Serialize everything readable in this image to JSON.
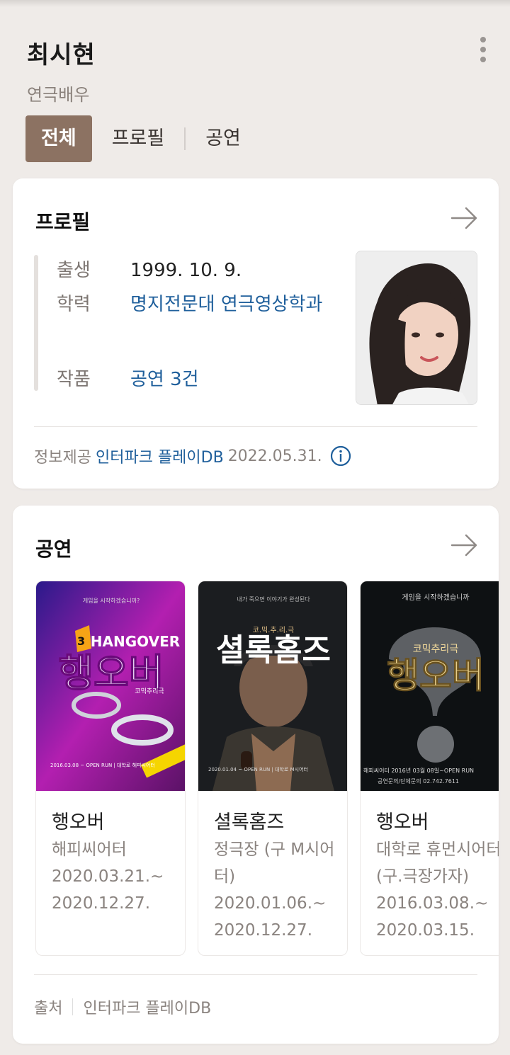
{
  "person": {
    "name": "최시현",
    "job": "연극배우"
  },
  "tabs": [
    "전체",
    "프로필",
    "공연"
  ],
  "profile": {
    "title": "프로필",
    "rows": [
      {
        "label": "출생",
        "value": "1999. 10. 9."
      },
      {
        "label": "학력",
        "value": "명지전문대 연극영상학과"
      },
      {
        "label": "작품",
        "value": "공연 3건"
      }
    ],
    "provider_label": "정보제공",
    "provider_source": "인터파크 플레이DB",
    "provider_date": "2022.05.31."
  },
  "performances": {
    "title": "공연",
    "items": [
      {
        "title": "행오버",
        "venue": "해피씨어터",
        "date_start": "2020.03.21.~",
        "date_end": "2020.12.27.",
        "poster_text": "행오버",
        "poster_top": "게임을 시작하겠습니까?",
        "poster_en": "HANGOVER",
        "poster_sub": "코믹추리극",
        "poster_info": "2016.03.08 ~ OPEN RUN | 대학로 해피씨어터"
      },
      {
        "title": "셜록홈즈",
        "venue": "정극장 (구 M시어터)",
        "date_start": "2020.01.06.~",
        "date_end": "2020.12.27.",
        "poster_text": "셜록홈즈",
        "poster_top": "내가 죽으면 이야기가 완성된다",
        "poster_sub": "코.믹.추.리.극",
        "poster_info": "2020.01.04 ~ OPEN RUN | 대학로 M시어터"
      },
      {
        "title": "행오버",
        "venue": "대학로 휴먼시어터 (구.극장가자)",
        "date_start": "2016.03.08.~",
        "date_end": "2020.03.15.",
        "poster_text": "행오버",
        "poster_top": "게임을 시작하겠습니까",
        "poster_sub": "코믹추리극",
        "poster_info": "해피씨어터 2016년 03월 08일~OPEN RUN",
        "poster_info2": "공연문의/단체문의 02.742.7611"
      }
    ],
    "source_label": "출처",
    "source_name": "인터파크 플레이DB"
  }
}
